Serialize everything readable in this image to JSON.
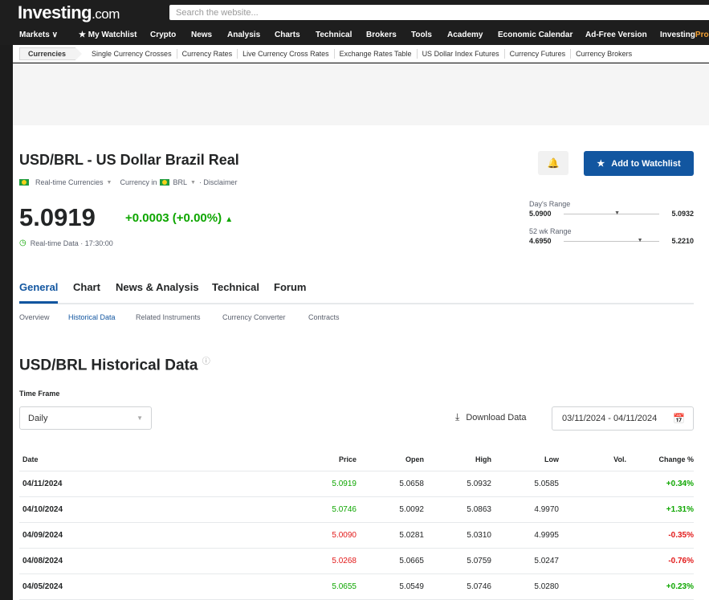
{
  "header": {
    "logo": "Investing",
    "logo_suffix": ".com",
    "search_placeholder": "Search the website...",
    "nav": [
      "Markets ∨",
      "★ My Watchlist",
      "Crypto",
      "News",
      "Analysis",
      "Charts",
      "Technical",
      "Brokers",
      "Tools",
      "Academy",
      "Economic Calendar",
      "Ad-Free Version",
      "Investing",
      "Pro"
    ]
  },
  "subnav": {
    "active": "Currencies",
    "items": [
      "Single Currency Crosses",
      "Currency Rates",
      "Live Currency Cross Rates",
      "Exchange Rates Table",
      "US Dollar Index Futures",
      "Currency Futures",
      "Currency Brokers"
    ]
  },
  "instrument": {
    "title": "USD/BRL - US Dollar Brazil Real",
    "category": "Real-time Currencies",
    "currency_in": "Currency in",
    "currency": "BRL",
    "disclaimer": "· Disclaimer",
    "price": "5.0919",
    "change": "+0.0003 (+0.00%)",
    "realtime": "Real-time Data · 17:30:00",
    "watchlist_label": "Add to Watchlist",
    "days_range": {
      "label": "Day's Range",
      "low": "5.0900",
      "high": "5.0932"
    },
    "wk52_range": {
      "label": "52 wk Range",
      "low": "4.6950",
      "high": "5.2210"
    }
  },
  "tabs": [
    "General",
    "Chart",
    "News & Analysis",
    "Technical",
    "Forum"
  ],
  "subtabs": [
    "Overview",
    "Historical Data",
    "Related Instruments",
    "Currency Converter",
    "Contracts"
  ],
  "historical": {
    "title": "USD/BRL Historical Data",
    "timeframe_label": "Time Frame",
    "timeframe": "Daily",
    "download_label": "Download Data",
    "daterange": "03/11/2024 - 04/11/2024",
    "columns": [
      "Date",
      "Price",
      "Open",
      "High",
      "Low",
      "Vol.",
      "Change %"
    ],
    "rows": [
      {
        "date": "04/11/2024",
        "price": "5.0919",
        "open": "5.0658",
        "high": "5.0932",
        "low": "5.0585",
        "vol": "",
        "change": "+0.34%",
        "dir": "up"
      },
      {
        "date": "04/10/2024",
        "price": "5.0746",
        "open": "5.0092",
        "high": "5.0863",
        "low": "4.9970",
        "vol": "",
        "change": "+1.31%",
        "dir": "up"
      },
      {
        "date": "04/09/2024",
        "price": "5.0090",
        "open": "5.0281",
        "high": "5.0310",
        "low": "4.9995",
        "vol": "",
        "change": "-0.35%",
        "dir": "down"
      },
      {
        "date": "04/08/2024",
        "price": "5.0268",
        "open": "5.0665",
        "high": "5.0759",
        "low": "5.0247",
        "vol": "",
        "change": "-0.76%",
        "dir": "down"
      },
      {
        "date": "04/05/2024",
        "price": "5.0655",
        "open": "5.0549",
        "high": "5.0746",
        "low": "5.0280",
        "vol": "",
        "change": "+0.23%",
        "dir": "up"
      }
    ]
  },
  "colors": {
    "up": "#0ea600",
    "down": "#e21a1a",
    "accent": "#1256a0"
  }
}
